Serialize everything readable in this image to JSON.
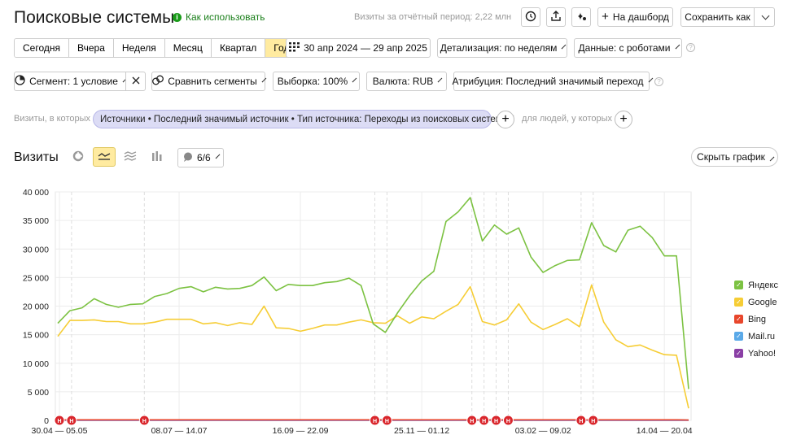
{
  "header": {
    "title": "Поисковые системы",
    "howto_label": "Как использовать",
    "visits_total": "Визиты за отчётный период: 2,22 млн",
    "dashboard_label": "На дашборд",
    "save_label": "Сохранить как"
  },
  "periods": {
    "items": [
      "Сегодня",
      "Вчера",
      "Неделя",
      "Месяц",
      "Квартал",
      "Год"
    ],
    "active": "Год",
    "date_range": "30 апр 2024 — 29 апр 2025",
    "detail": "Детализация: по неделям",
    "data_mode": "Данные: с роботами"
  },
  "controls": {
    "segment": "Сегмент: 1 условие",
    "compare": "Сравнить сегменты",
    "sample": "Выборка: 100%",
    "currency": "Валюта: RUB",
    "attribution": "Атрибуция: Последний значимый переход"
  },
  "filter": {
    "prefix": "Визиты, в которых",
    "chip": "Источники • Последний значимый источник • Тип источника: Переходы из поисковых систем",
    "people": "для людей, у которых"
  },
  "chart_header": {
    "title": "Визиты",
    "series_count": "6/6",
    "hide_label": "Скрыть график"
  },
  "chart_data": {
    "type": "line",
    "ylim": [
      0,
      40000
    ],
    "yticks": [
      "0",
      "5 000",
      "10 000",
      "15 000",
      "20 000",
      "25 000",
      "30 000",
      "35 000",
      "40 000"
    ],
    "xticks": [
      {
        "label": "30.04 — 05.05",
        "i": 0
      },
      {
        "label": "08.07 — 14.07",
        "i": 10
      },
      {
        "label": "16.09 — 22.09",
        "i": 20
      },
      {
        "label": "25.11 — 01.12",
        "i": 30
      },
      {
        "label": "03.02 — 09.02",
        "i": 40
      },
      {
        "label": "14.04 — 20.04",
        "i": 50
      }
    ],
    "series": [
      {
        "name": "Яндекс",
        "color": "#7cc242",
        "values": [
          17000,
          19200,
          19700,
          21300,
          20300,
          19800,
          20300,
          20400,
          21700,
          22200,
          23100,
          23400,
          22500,
          23300,
          23000,
          23100,
          23600,
          25100,
          22700,
          23800,
          23600,
          23600,
          24100,
          24300,
          24900,
          23600,
          16900,
          15400,
          18800,
          21800,
          24400,
          26100,
          34800,
          36500,
          39000,
          31400,
          34200,
          32600,
          33700,
          28600,
          25900,
          27100,
          28000,
          28100,
          34600,
          30600,
          29500,
          33300,
          34000,
          32000,
          28800,
          28800,
          5500
        ],
        "dashed_gaps": []
      },
      {
        "name": "Google",
        "color": "#f6cd35",
        "values": [
          14700,
          17500,
          17500,
          17600,
          17300,
          17300,
          16900,
          16900,
          17200,
          17700,
          17700,
          17700,
          16900,
          17100,
          16600,
          17100,
          16800,
          20000,
          16200,
          16100,
          15600,
          16100,
          16700,
          16700,
          17200,
          17600,
          17100,
          17000,
          18300,
          17000,
          18100,
          17800,
          19100,
          20300,
          23400,
          17300,
          16700,
          17600,
          20400,
          17200,
          15900,
          16800,
          17800,
          16400,
          23700,
          17200,
          14100,
          12900,
          13200,
          12300,
          11500,
          11400,
          2100
        ]
      },
      {
        "name": "Bing",
        "color": "#e8462c",
        "values": [
          100,
          100,
          100,
          100,
          100,
          100,
          100,
          100,
          100,
          100,
          100,
          100,
          100,
          100,
          100,
          100,
          100,
          100,
          100,
          100,
          100,
          100,
          100,
          100,
          100,
          100,
          100,
          100,
          100,
          100,
          100,
          100,
          100,
          100,
          100,
          100,
          100,
          100,
          100,
          100,
          100,
          100,
          100,
          100,
          100,
          100,
          100,
          100,
          100,
          100,
          100,
          100,
          50
        ]
      },
      {
        "name": "Mail.ru",
        "color": "#5aa9e8",
        "values": [
          80,
          80,
          80,
          80,
          80,
          80,
          80,
          80,
          80,
          80,
          80,
          80,
          80,
          80,
          80,
          80,
          80,
          80,
          80,
          80,
          80,
          80,
          80,
          80,
          80,
          80,
          80,
          80,
          80,
          80,
          80,
          80,
          80,
          80,
          80,
          80,
          80,
          80,
          80,
          80,
          80,
          80,
          80,
          80,
          80,
          80,
          80,
          80,
          80,
          80,
          80,
          80,
          40
        ]
      },
      {
        "name": "Yahoo!",
        "color": "#8a3fa5",
        "values": [
          20,
          20,
          20,
          20,
          20,
          20,
          20,
          20,
          20,
          20,
          20,
          20,
          20,
          20,
          20,
          20,
          20,
          20,
          20,
          20,
          20,
          20,
          20,
          20,
          20,
          20,
          20,
          20,
          20,
          20,
          20,
          20,
          20,
          20,
          20,
          20,
          20,
          20,
          20,
          20,
          20,
          20,
          20,
          20,
          20,
          20,
          20,
          20,
          20,
          20,
          20,
          20,
          10
        ]
      }
    ],
    "annotation_points": [
      0,
      1,
      7,
      26,
      27,
      34,
      35,
      36,
      37,
      43,
      44
    ],
    "annotation_label": "Н",
    "legend_position": "right"
  }
}
